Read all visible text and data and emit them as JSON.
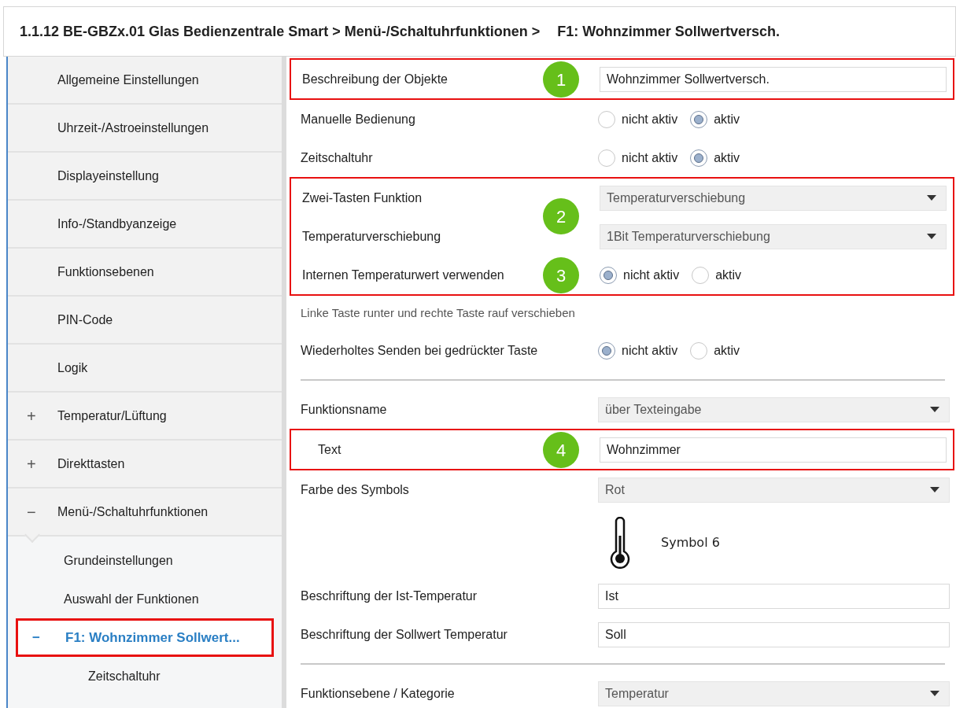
{
  "header": {
    "breadcrumb": "1.1.12 BE-GBZx.01 Glas Bedienzentrale Smart > Menü-/Schaltuhrfunktionen >",
    "current": "F1: Wohnzimmer Sollwertversch."
  },
  "sidebar": {
    "items": [
      {
        "label": "Allgemeine Einstellungen",
        "selected": false
      },
      {
        "label": "Uhrzeit-/Astroeinstellungen",
        "selected": false
      },
      {
        "label": "Displayeinstellung",
        "selected": false
      },
      {
        "label": "Info-/Standbyanzeige",
        "selected": false
      },
      {
        "label": "Funktionsebenen",
        "selected": false
      },
      {
        "label": "PIN-Code",
        "selected": false
      },
      {
        "label": "Logik",
        "selected": false
      },
      {
        "label": "Temperatur/Lüftung",
        "expander": "+",
        "expanded": false,
        "selected": false
      },
      {
        "label": "Direkttasten",
        "expander": "+",
        "expanded": false,
        "selected": false
      },
      {
        "label": "Menü-/Schaltuhrfunktionen",
        "expander": "−",
        "expanded": true,
        "selected": false,
        "children": [
          {
            "label": "Grundeinstellungen",
            "selected": false
          },
          {
            "label": "Auswahl der Funktionen",
            "selected": false
          },
          {
            "label": "F1: Wohnzimmer Sollwert...",
            "expander": "−",
            "expanded": true,
            "selected": true,
            "children": [
              {
                "label": "Zeitschaltuhr",
                "selected": false
              }
            ]
          }
        ]
      }
    ]
  },
  "parameters": [
    {
      "kind": "box",
      "rows": [
        {
          "kind": "text",
          "label": "Beschreibung der Objekte",
          "value": "Wohnzimmer Sollwertversch.",
          "badge": "1"
        }
      ]
    },
    {
      "kind": "radio",
      "label": "Manuelle Bedienung",
      "options": [
        {
          "label": "nicht aktiv",
          "selected": false
        },
        {
          "label": "aktiv",
          "selected": true
        }
      ]
    },
    {
      "kind": "radio",
      "label": "Zeitschaltuhr",
      "options": [
        {
          "label": "nicht aktiv",
          "selected": false
        },
        {
          "label": "aktiv",
          "selected": true
        }
      ]
    },
    {
      "kind": "box",
      "rows": [
        {
          "kind": "select",
          "label": "Zwei-Tasten Funktion",
          "value": "Temperaturverschiebung",
          "badge": "2"
        },
        {
          "kind": "select",
          "label": "Temperaturverschiebung",
          "value": "1Bit Temperaturverschiebung"
        },
        {
          "kind": "radio",
          "label": "Internen Temperaturwert verwenden",
          "badge": "3",
          "options": [
            {
              "label": "nicht aktiv",
              "selected": true
            },
            {
              "label": "aktiv",
              "selected": false
            }
          ]
        }
      ]
    },
    {
      "kind": "note",
      "label": "Linke Taste runter und rechte Taste rauf verschieben"
    },
    {
      "kind": "radio",
      "label": "Wiederholtes Senden bei gedrückter Taste",
      "options": [
        {
          "label": "nicht aktiv",
          "selected": true
        },
        {
          "label": "aktiv",
          "selected": false
        }
      ]
    },
    {
      "kind": "divider"
    },
    {
      "kind": "select",
      "label": "Funktionsname",
      "value": "über Texteingabe"
    },
    {
      "kind": "box",
      "rows": [
        {
          "kind": "text",
          "label": "Text",
          "value": "Wohnzimmer",
          "badge": "4",
          "indented": true
        }
      ]
    },
    {
      "kind": "select",
      "label": "Farbe des Symbols",
      "value": "Rot"
    },
    {
      "kind": "symbol",
      "caption": "Symbol 6"
    },
    {
      "kind": "text",
      "label": "Beschriftung der Ist-Temperatur",
      "value": "Ist"
    },
    {
      "kind": "text",
      "label": "Beschriftung der Sollwert Temperatur",
      "value": "Soll"
    },
    {
      "kind": "divider"
    },
    {
      "kind": "select",
      "label": "Funktionsebene / Kategorie",
      "value": "Temperatur"
    }
  ]
}
